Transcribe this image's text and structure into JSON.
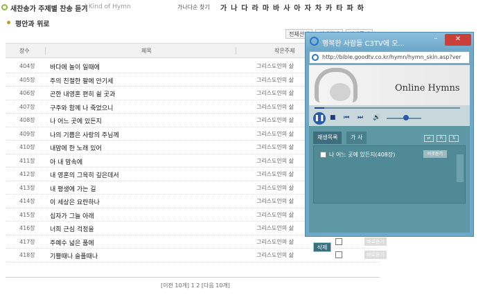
{
  "header": {
    "title": "새찬송가 주제별 찬송 듣기",
    "subtitle": "| Kind of Hymn",
    "search_label": "가나다순 찾기",
    "letters": [
      "가",
      "나",
      "다",
      "라",
      "마",
      "바",
      "사",
      "아",
      "자",
      "차",
      "카",
      "타",
      "파",
      "하"
    ]
  },
  "category": "평안과 위로",
  "top_buttons": [
    "전체선택",
    "선택해제",
    "선택듣기"
  ],
  "table": {
    "headers": {
      "no": "장수",
      "name": "제목",
      "theme": "작은주제"
    },
    "rows": [
      {
        "no": "404장",
        "name": "바다에 놀이 일때에",
        "theme": "그리스도인의 삶"
      },
      {
        "no": "405장",
        "name": "주의 친절한 팔에 안기세",
        "theme": "그리스도인의 삶"
      },
      {
        "no": "406장",
        "name": "곤한 내영혼 편히 쉴 곳과",
        "theme": "그리스도인의 삶"
      },
      {
        "no": "407장",
        "name": "구주와 함께 나 죽었으니",
        "theme": "그리스도인의 삶"
      },
      {
        "no": "408장",
        "name": "나 어느 곳에 있든지",
        "theme": "그리스도인의 삶"
      },
      {
        "no": "409장",
        "name": "나의 기쁨은 사랑의 주님께",
        "theme": "그리스도인의 삶"
      },
      {
        "no": "410장",
        "name": "내맘에 한 노래 있어",
        "theme": "그리스도인의 삶"
      },
      {
        "no": "411장",
        "name": "아 내 맘속에",
        "theme": "그리스도인의 삶"
      },
      {
        "no": "412장",
        "name": "내 영혼의 그윽히 깊은데서",
        "theme": "그리스도인의 삶"
      },
      {
        "no": "413장",
        "name": "내 평생에 가는 길",
        "theme": "그리스도인의 삶"
      },
      {
        "no": "414장",
        "name": "이 세상은 요란하나",
        "theme": "그리스도인의 삶"
      },
      {
        "no": "415장",
        "name": "십자가 그늘 아래",
        "theme": "그리스도인의 삶"
      },
      {
        "no": "416장",
        "name": "너희 근심 걱정을",
        "theme": "그리스도인의 삶"
      },
      {
        "no": "417장",
        "name": "주예수 넓은 품에",
        "theme": "그리스도인의 삶"
      },
      {
        "no": "418장",
        "name": "기쁠때나 슬플때나",
        "theme": "그리스도인의 삶"
      }
    ],
    "play_label": "바로듣기"
  },
  "pager": "[이전 10개] 1 2 [다음 10개]",
  "popup": {
    "title": "행복한 사람들 C3TV에 오...",
    "url": "http://bible.goodtv.co.kr/hymn/hymn_skin.asp?ver",
    "logo": "Online Hymns",
    "tabs": [
      "재생목록",
      "가 사"
    ],
    "playlist_item": "나 어느 곳에 있든지(408장)",
    "play_label": "바로듣기",
    "delete_label": "삭제"
  }
}
